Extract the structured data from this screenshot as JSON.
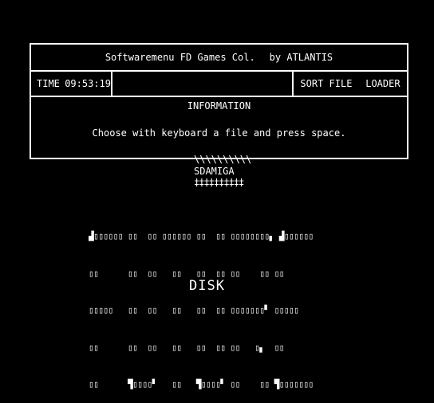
{
  "header": {
    "title": "Softwaremenu FD Games Col.",
    "author": "by ATLANTIS"
  },
  "status": {
    "time_label": "TIME",
    "time_value": "09:53:19"
  },
  "menu": {
    "sort_file": "SORT FILE",
    "loader": "LOADER"
  },
  "info": {
    "title": "INFORMATION",
    "text": "Choose with keyboard a file and press space."
  },
  "banner": {
    "wave": "\\\\\\\\\\\\\\\\\\\\",
    "group": "SDAMIGA",
    "underline": "‡‡‡‡‡‡‡‡‡‡"
  },
  "logo": {
    "lines": [
      "▟▯▯▯▯▯▯ ▯▯  ▯▯ ▯▯▯▯▯▯ ▯▯  ▯▯ ▯▯▯▯▯▯▯▯▖ ▟▯▯▯▯▯▯",
      "▯▯      ▯▯  ▯▯   ▯▯   ▯▯  ▯▯ ▯▯    ▯▯ ▯▯",
      "▯▯▯▯▯   ▯▯  ▯▯   ▯▯   ▯▯  ▯▯ ▯▯▯▯▯▯▯▘ ▯▯▯▯▯",
      "▯▯      ▯▯  ▯▯   ▯▯   ▯▯  ▯▯ ▯▯   ▯▖  ▯▯",
      "▯▯      ▜▯▯▯▯▘   ▯▯   ▜▯▯▯▯▘ ▯▯    ▯▯ ▜▯▯▯▯▯▯▯"
    ],
    "subtitle": "DISK"
  }
}
